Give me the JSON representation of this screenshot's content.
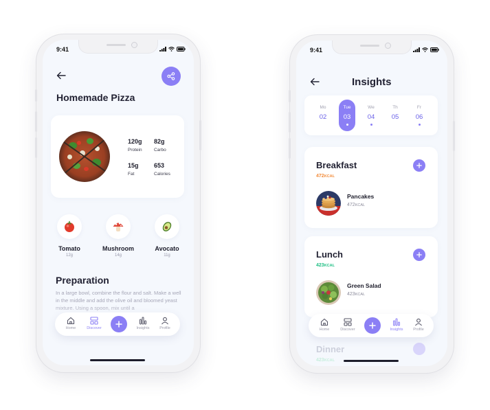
{
  "status_bar": {
    "time": "9:41"
  },
  "recipe": {
    "title": "Homemade Pizza",
    "nutrition": [
      {
        "value": "120g",
        "label": "Protein"
      },
      {
        "value": "82g",
        "label": "Carbo"
      },
      {
        "value": "15g",
        "label": "Fat"
      },
      {
        "value": "653",
        "label": "Calories"
      }
    ],
    "ingredients": [
      {
        "name": "Tomato",
        "amount": "12g",
        "icon": "tomato-icon"
      },
      {
        "name": "Mushroom",
        "amount": "14g",
        "icon": "mushroom-icon"
      },
      {
        "name": "Avocato",
        "amount": "11g",
        "icon": "avocado-icon"
      }
    ],
    "preparation_title": "Preparation",
    "preparation_text": "In a large bowl, combine the flour and salt. Make a well in the middle and add the olive oil and bloomed yeast mixture. Using a spoon, mix until a"
  },
  "nav_left": {
    "items": [
      {
        "label": "Home",
        "icon": "home-icon",
        "active": false
      },
      {
        "label": "Discover",
        "icon": "discover-icon",
        "active": true
      },
      {
        "label": "Insights",
        "icon": "insights-icon",
        "active": false
      },
      {
        "label": "Profile",
        "icon": "profile-icon",
        "active": false
      }
    ]
  },
  "insights": {
    "title": "Insights",
    "week": [
      {
        "day": "Mo",
        "date": "02",
        "dot": false,
        "active": false
      },
      {
        "day": "Tue",
        "date": "03",
        "dot": true,
        "active": true
      },
      {
        "day": "We",
        "date": "04",
        "dot": true,
        "active": false
      },
      {
        "day": "Th",
        "date": "05",
        "dot": false,
        "active": false
      },
      {
        "day": "Fr",
        "date": "06",
        "dot": true,
        "active": false
      }
    ],
    "meals": [
      {
        "title": "Breakfast",
        "kcal": "472",
        "kcal_unit": "KCAL",
        "color": "#f28c3a",
        "food": "Pancakes",
        "food_kcal": "472",
        "food_unit": "KCAL"
      },
      {
        "title": "Lunch",
        "kcal": "423",
        "kcal_unit": "KCAL",
        "color": "#1fbf84",
        "food": "Green Salad",
        "food_kcal": "423",
        "food_unit": "KCAL"
      },
      {
        "title": "Dinner",
        "kcal": "423",
        "kcal_unit": "KCAL",
        "color": "#1fbf84"
      }
    ]
  },
  "nav_right": {
    "items": [
      {
        "label": "Home",
        "icon": "home-icon",
        "active": false
      },
      {
        "label": "Discover",
        "icon": "discover-icon",
        "active": false
      },
      {
        "label": "Insights",
        "icon": "insights-icon",
        "active": true
      },
      {
        "label": "Profile",
        "icon": "profile-icon",
        "active": false
      }
    ]
  },
  "colors": {
    "accent": "#8b7ff5",
    "breakfast_kcal": "#f28c3a",
    "lunch_kcal": "#1fbf84",
    "text": "#222233"
  }
}
